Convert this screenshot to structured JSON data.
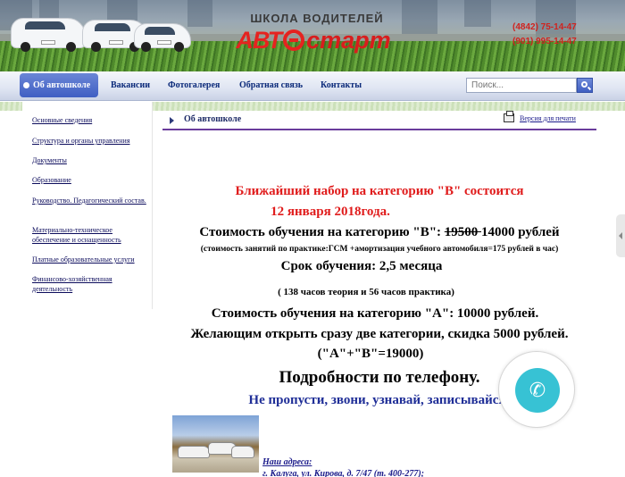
{
  "header": {
    "logo_subtitle": "ШКОЛА ВОДИТЕЛЕЙ",
    "logo_part1": "АВТ",
    "logo_part2": "старт",
    "phones": [
      "(4842) 75-14-47",
      "(901) 995-14-47"
    ]
  },
  "nav": {
    "active": "Об автошколе",
    "items": [
      "Вакансии",
      "Фотогалерея",
      "Обратная связь",
      "Контакты"
    ],
    "search_placeholder": "Поиск..."
  },
  "sidebar": {
    "items": [
      "Основные сведения",
      "Структура и органы управления",
      "Документы",
      "Образование",
      "Руководство. Педагогический состав.",
      "Материально-техническое обеспечение и оснащенность",
      "Платные образовательные услуги",
      "Финансово-хозяйственная деятельность"
    ]
  },
  "main": {
    "breadcrumb": "Об автошколе",
    "print_label": "Версия для печати",
    "headline_1": "Ближайший набор на категорию \"В\" состоится",
    "headline_2": "12 января 2018года.",
    "price_b_prefix": "Стоимость обучения на категорию \"В\": ",
    "price_b_old": "19500 ",
    "price_b_new": "14000 рублей",
    "practice_note": "(стоимость занятий по практике:ГСМ +амортизация учебного автомобиля=175 рублей в час)",
    "duration": "Срок обучения: 2,5 месяца",
    "hours": "( 138 часов теория и 56 часов практика)",
    "price_a": "Стоимость обучения на категорию \"А\": 10000 рублей.",
    "discount": "Желающим открыть сразу две категории, скидка 5000 рублей.",
    "combo": "(\"А\"+\"В\"=19000)",
    "phone_details": "Подробности по телефону.",
    "cta": "Не пропусти, звони, узнавай, записывайся!",
    "address_title": "Наш адреса:",
    "address_line": "г. Калуга, ул. Кирова, д. 7/47 (т. 400-277);"
  },
  "widget": {
    "icon": "phone-icon"
  },
  "colors": {
    "accent_red": "#e01c1c",
    "accent_navy": "#1f2e97",
    "nav_active": "#3f5fc3",
    "call_button": "#37c2d4"
  }
}
